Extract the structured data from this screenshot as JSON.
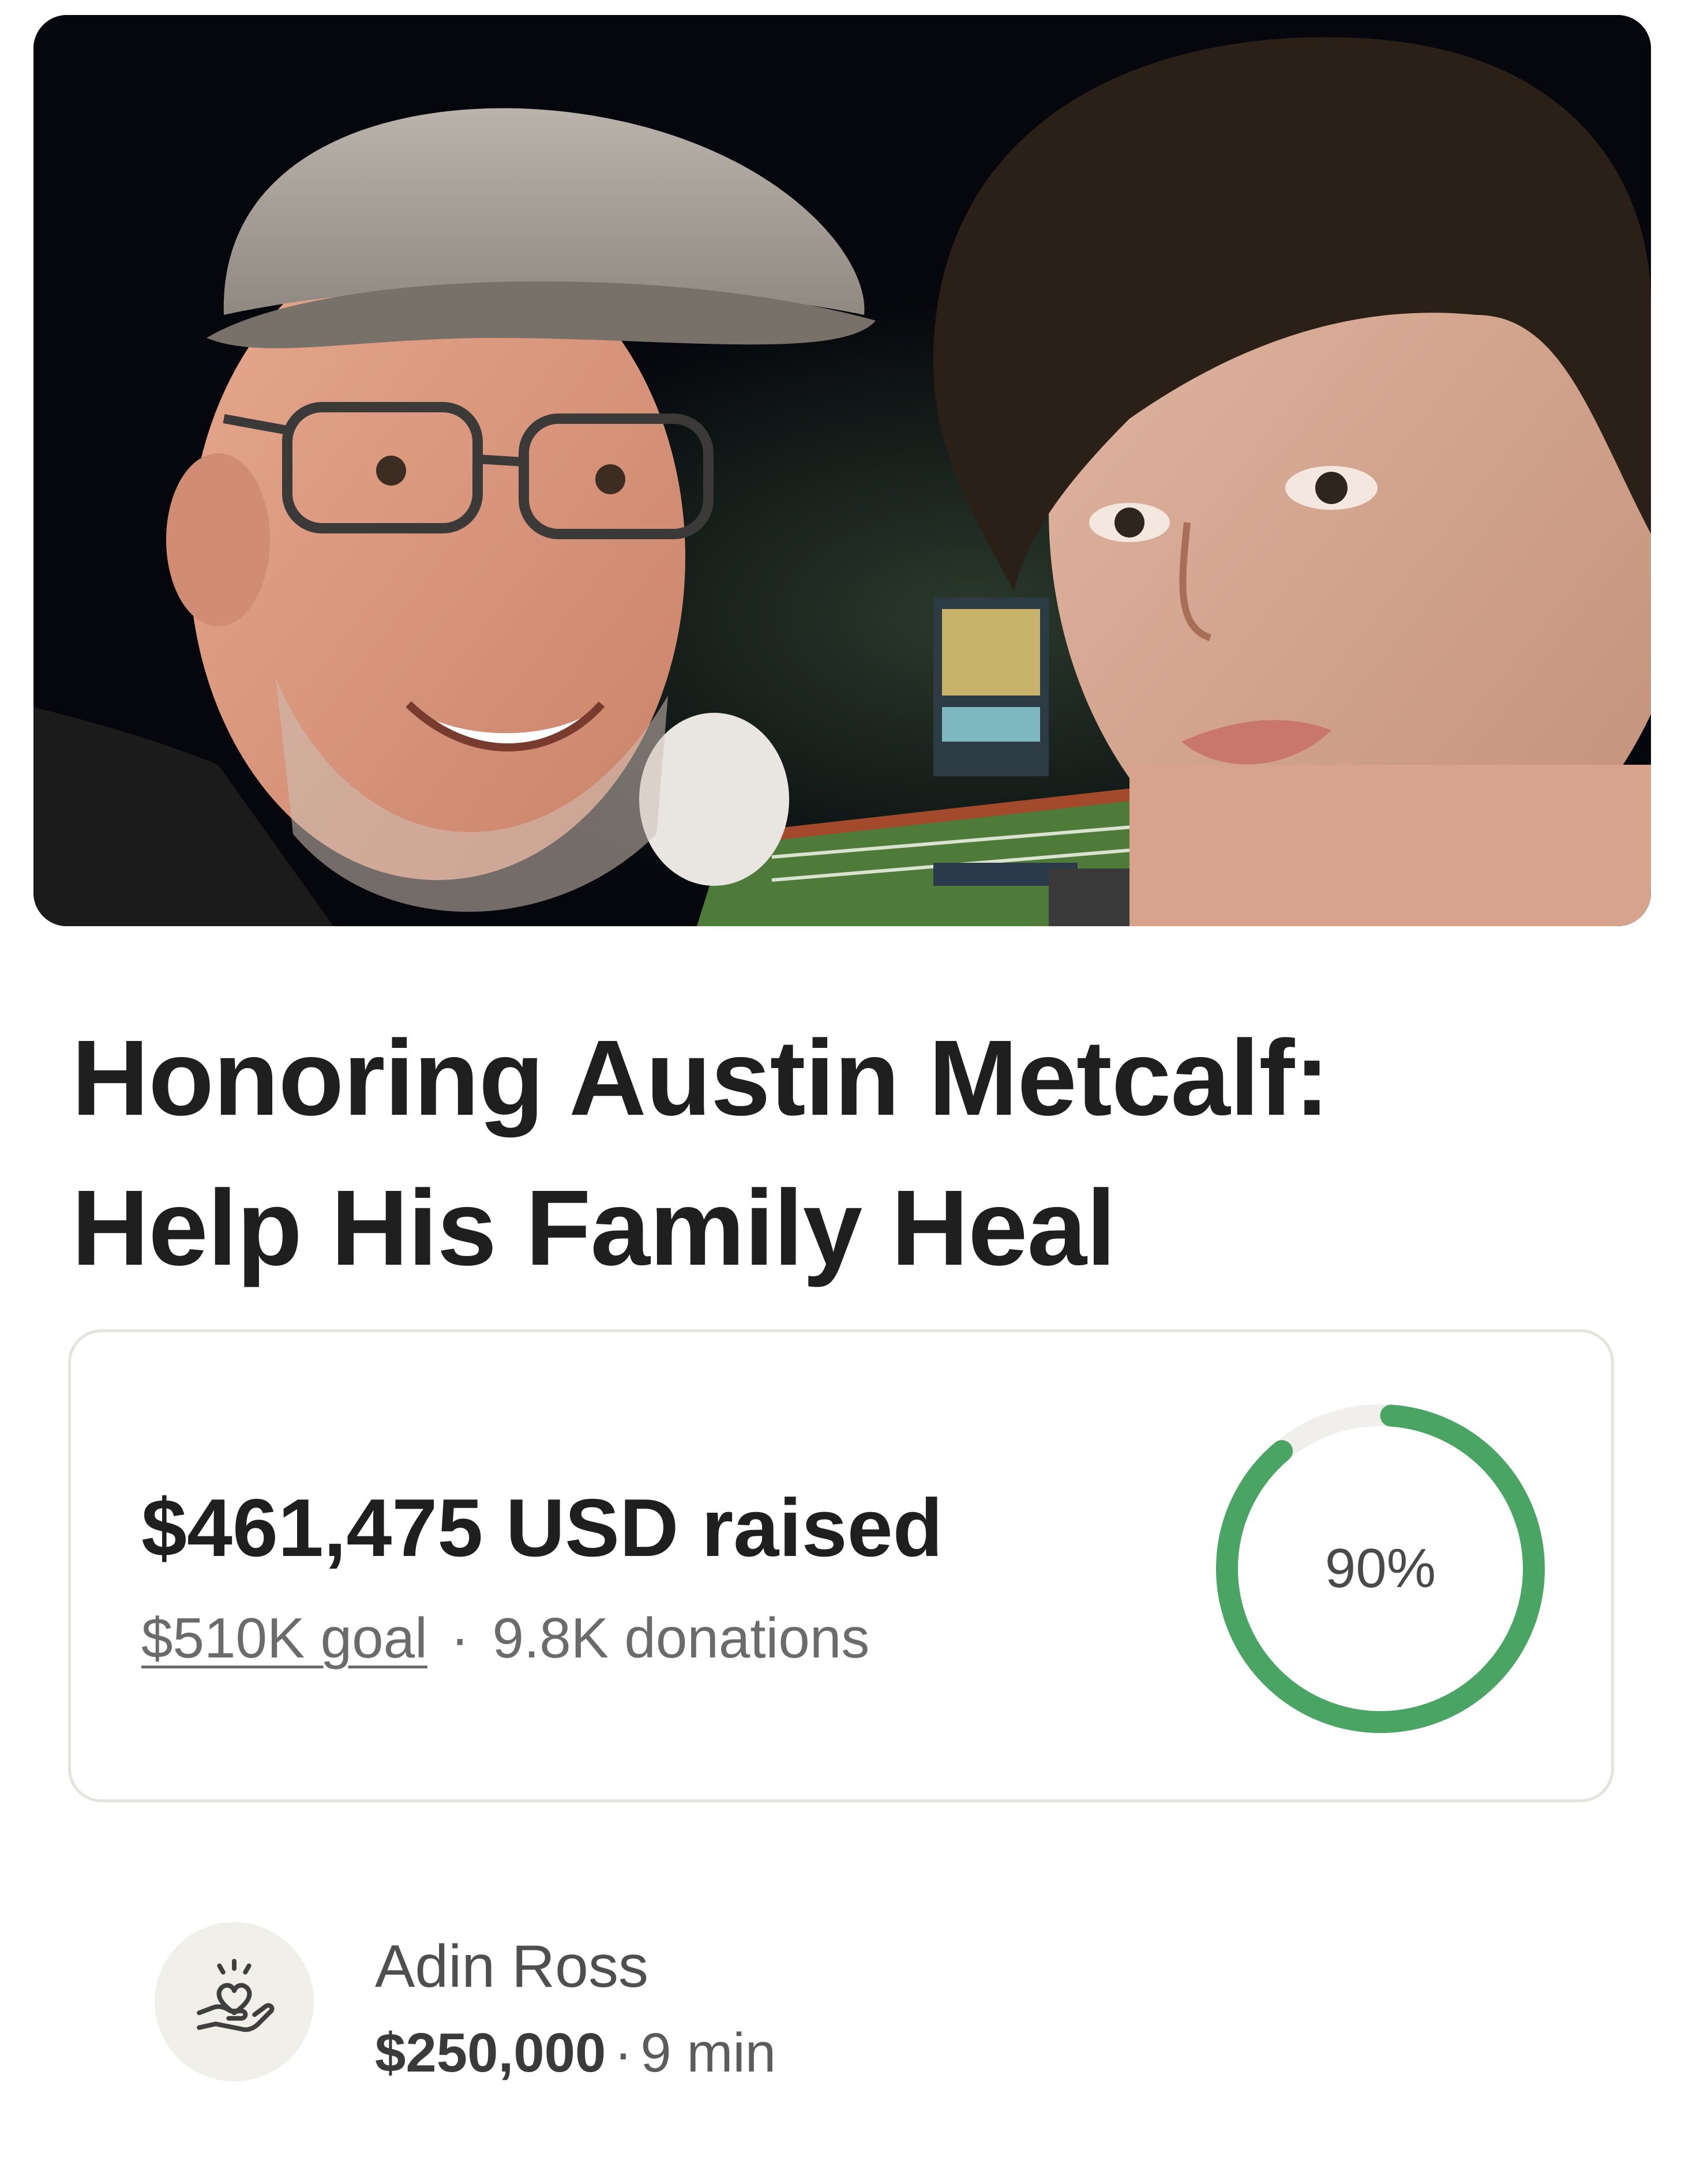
{
  "campaign": {
    "title_line1": "Honoring Austin Metcalf:",
    "title_line2": "Help His Family Heal",
    "raised_text": "$461,475 USD raised",
    "goal_text": "$510K goal",
    "separator": "·",
    "donations_text": "9.8K donations",
    "progress_percent": 90,
    "progress_label": "90%",
    "progress_color": "#4aa564",
    "track_color": "#f0efec"
  },
  "donation": {
    "donor_name": "Adin Ross",
    "amount": "$250,000",
    "separator": "·",
    "time_ago": "9 min",
    "icon": "heart-in-hand-icon"
  }
}
